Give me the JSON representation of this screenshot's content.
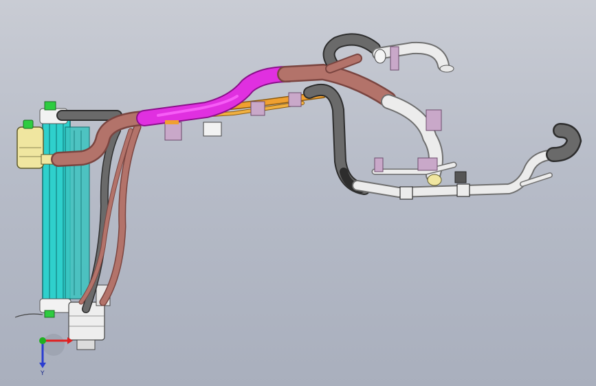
{
  "viewport": {
    "background_top": "#c9ccd4",
    "background_bottom": "#a9afbd"
  },
  "colors": {
    "rubber_hose": "#b3736a",
    "rubber_hose_dark": "#7a4540",
    "selected_hose": "#e030e0",
    "dark_hose": "#6a6a6a",
    "dark_hose_edge": "#2d2d2d",
    "white_pipe": "#ececec",
    "white_pipe_edge": "#6f6f6f",
    "radiator": "#2fd0cc",
    "radiator_edge": "#0e6e6e",
    "reservoir": "#f0e6a0",
    "reservoir_edge": "#5e5a2a",
    "bracket": "#c9a8c9",
    "orange_pipe": "#f0a030",
    "clip_green": "#2ecc40"
  },
  "triad": {
    "axis_label": "Y",
    "x_color": "#e02020",
    "y_color": "#2a3cd0",
    "z_color": "#20b020"
  }
}
